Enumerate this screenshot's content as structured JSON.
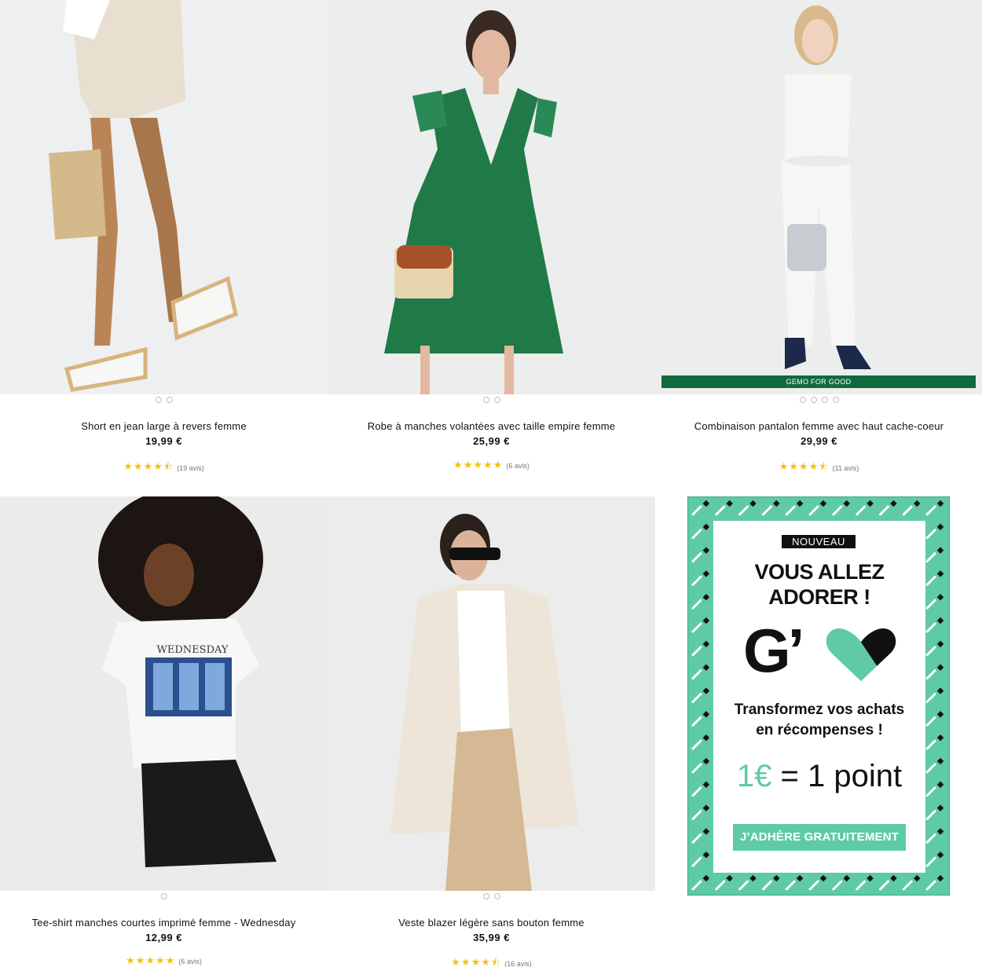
{
  "products": [
    {
      "title": "Short en jean large à revers femme",
      "price": "19,99 €",
      "stars": "★★★★⯪",
      "reviews": "(19 avis)"
    },
    {
      "title": "Robe à manches volantées avec taille empire femme",
      "price": "25,99 €",
      "stars": "★★★★★",
      "reviews": "(6 avis)"
    },
    {
      "title": "Combinaison pantalon femme avec haut cache-coeur",
      "price": "29,99 €",
      "stars": "★★★★⯪",
      "reviews": "(11 avis)",
      "badge": "GEMO FOR GOOD"
    },
    {
      "title": "Tee-shirt manches courtes imprimé femme - Wednesday",
      "price": "12,99 €",
      "stars": "★★★★★",
      "reviews": "(6 avis)",
      "print": "WEDNESDAY"
    },
    {
      "title": "Veste blazer légère sans bouton femme",
      "price": "35,99 €",
      "stars": "★★★★⯪",
      "reviews": "(16 avis)"
    }
  ],
  "ratings": [
    4.5,
    5,
    4.5,
    5,
    4.5
  ],
  "promo": {
    "tag": "NOUVEAU",
    "headline_1": "VOUS ALLEZ",
    "headline_2": "ADORER !",
    "logo_letter": "G’",
    "sub_1": "Transformez vos achats",
    "sub_2": "en récompenses !",
    "points_euro": "1€",
    "points_rest": " = 1 point",
    "cta": "J’ADHÈRE GRATUITEMENT"
  },
  "colors": {
    "star": "#f4c20d",
    "badge_green": "#0f6b3d",
    "promo_mint": "#5ecaa8"
  }
}
